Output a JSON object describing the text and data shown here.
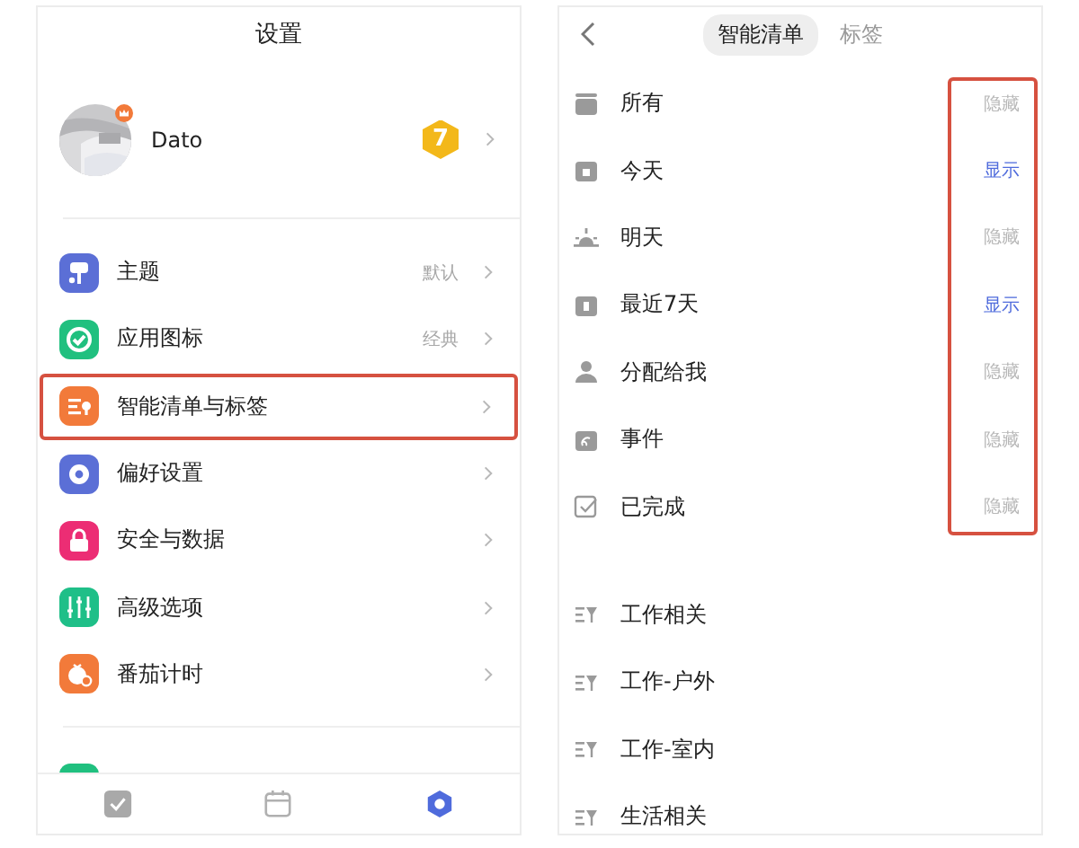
{
  "settings": {
    "title": "设置",
    "profile": {
      "name": "Dato",
      "level": "7"
    },
    "items": [
      {
        "kind": "theme",
        "label": "主题",
        "value": "默认",
        "color": "#5b6fd6",
        "highlighted": false
      },
      {
        "kind": "app_icon",
        "label": "应用图标",
        "value": "经典",
        "color": "#20c07f",
        "highlighted": false
      },
      {
        "kind": "smart_list",
        "label": "智能清单与标签",
        "color": "#f27a3a",
        "highlighted": true
      },
      {
        "kind": "preferences",
        "label": "偏好设置",
        "color": "#5b6fd6",
        "highlighted": false
      },
      {
        "kind": "security",
        "label": "安全与数据",
        "color": "#ec2d74",
        "highlighted": false
      },
      {
        "kind": "advanced",
        "label": "高级选项",
        "color": "#1fbf88",
        "highlighted": false
      },
      {
        "kind": "pomodoro",
        "label": "番茄计时",
        "color": "#f27a3a",
        "highlighted": false
      }
    ],
    "partial_item": {
      "color": "#20c07f"
    },
    "tab_bar": [
      {
        "kind": "tasks",
        "selected": false
      },
      {
        "kind": "calendar",
        "selected": false
      },
      {
        "kind": "settings",
        "selected": true
      }
    ]
  },
  "smart_lists_page": {
    "tabs": [
      {
        "label": "智能清单",
        "selected": true
      },
      {
        "label": "标签",
        "selected": false
      }
    ],
    "status_column_highlighted": true,
    "lists": [
      {
        "kind": "all",
        "label": "所有",
        "status": "隐藏",
        "shown": false
      },
      {
        "kind": "today",
        "label": "今天",
        "status": "显示",
        "shown": true
      },
      {
        "kind": "tomorrow",
        "label": "明天",
        "status": "隐藏",
        "shown": false
      },
      {
        "kind": "week",
        "label": "最近7天",
        "status": "显示",
        "shown": true
      },
      {
        "kind": "assigned",
        "label": "分配给我",
        "status": "隐藏",
        "shown": false
      },
      {
        "kind": "events",
        "label": "事件",
        "status": "隐藏",
        "shown": false
      },
      {
        "kind": "completed",
        "label": "已完成",
        "status": "隐藏",
        "shown": false
      }
    ],
    "filters": [
      {
        "label": "工作相关"
      },
      {
        "label": "工作-户外"
      },
      {
        "label": "工作-室内"
      },
      {
        "label": "生活相关"
      }
    ]
  }
}
